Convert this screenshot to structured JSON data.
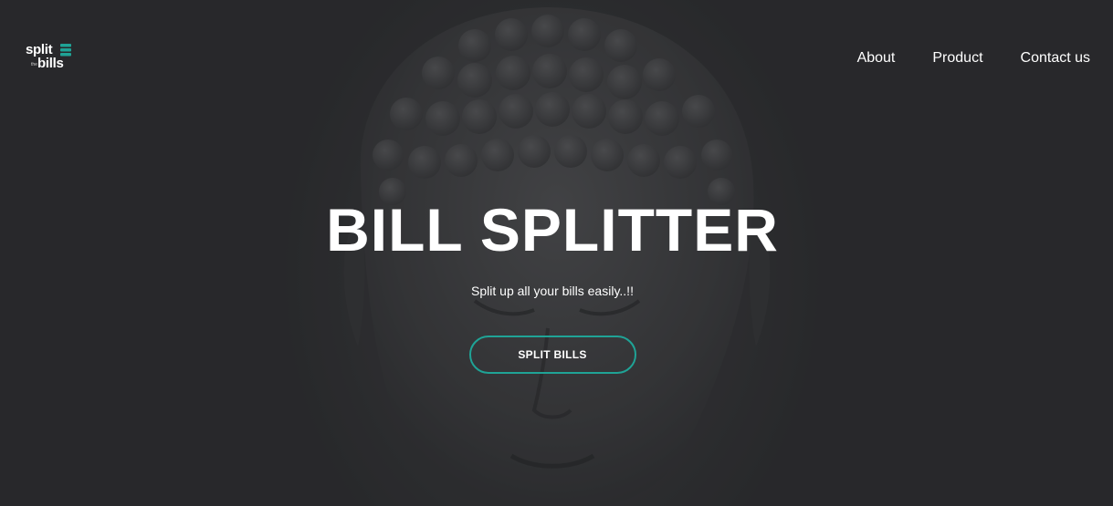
{
  "logo": {
    "line1": "split",
    "small": "the",
    "line2": "bills",
    "accent_color": "#1fa396"
  },
  "nav": {
    "items": [
      {
        "label": "About"
      },
      {
        "label": "Product"
      },
      {
        "label": "Contact us"
      }
    ]
  },
  "hero": {
    "title": "BILL SPLITTER",
    "subtitle": "Split up all your bills easily..!!",
    "cta_label": "SPLIT BILLS",
    "cta_border_color": "#1fa396"
  },
  "background": {
    "image": "buddha-head-photo"
  }
}
